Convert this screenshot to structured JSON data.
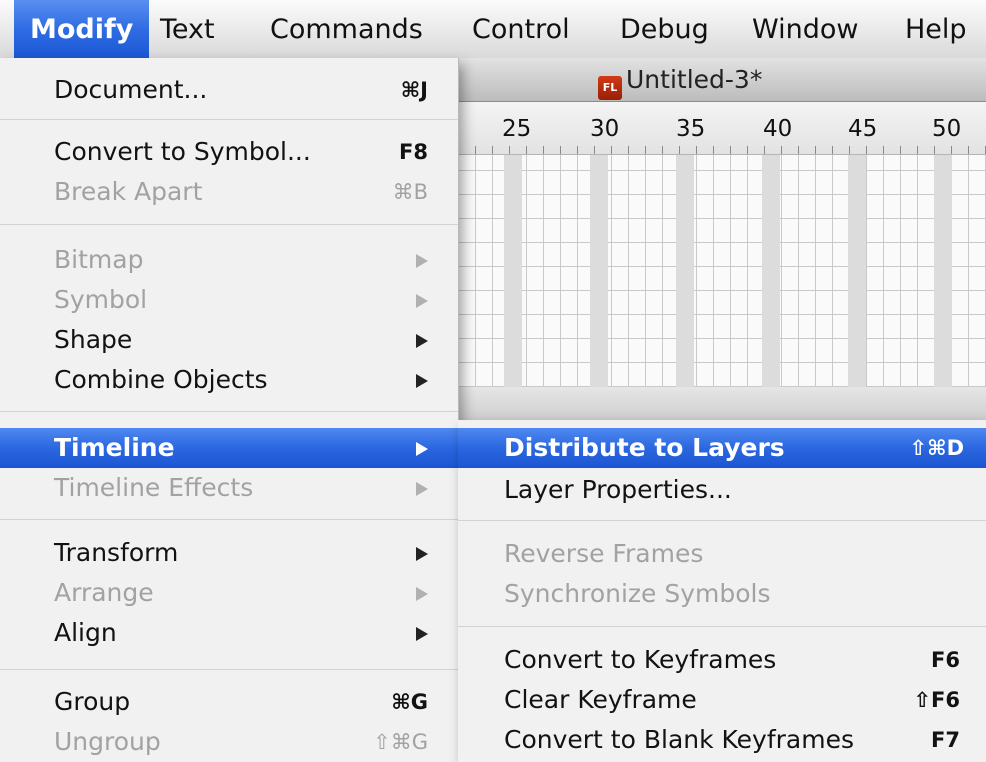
{
  "menubar": {
    "items": [
      "Modify",
      "Text",
      "Commands",
      "Control",
      "Debug",
      "Window",
      "Help"
    ]
  },
  "document": {
    "app_icon": "FL",
    "title": "Untitled-3*",
    "ruler": [
      "25",
      "30",
      "35",
      "40",
      "45",
      "50"
    ]
  },
  "modify_menu": {
    "document": {
      "label": "Document...",
      "shortcut": "⌘J"
    },
    "convert_symbol": {
      "label": "Convert to Symbol...",
      "shortcut": "F8"
    },
    "break_apart": {
      "label": "Break Apart",
      "shortcut": "⌘B"
    },
    "bitmap": {
      "label": "Bitmap"
    },
    "symbol": {
      "label": "Symbol"
    },
    "shape": {
      "label": "Shape"
    },
    "combine": {
      "label": "Combine Objects"
    },
    "timeline": {
      "label": "Timeline"
    },
    "timeline_effects": {
      "label": "Timeline Effects"
    },
    "transform": {
      "label": "Transform"
    },
    "arrange": {
      "label": "Arrange"
    },
    "align": {
      "label": "Align"
    },
    "group": {
      "label": "Group",
      "shortcut": "⌘G"
    },
    "ungroup": {
      "label": "Ungroup",
      "shortcut": "⇧⌘G"
    }
  },
  "timeline_submenu": {
    "distribute": {
      "label": "Distribute to Layers",
      "shortcut": "⇧⌘D"
    },
    "layer_props": {
      "label": "Layer Properties..."
    },
    "reverse": {
      "label": "Reverse Frames"
    },
    "sync": {
      "label": "Synchronize Symbols"
    },
    "convert_kf": {
      "label": "Convert to Keyframes",
      "shortcut": "F6"
    },
    "clear_kf": {
      "label": "Clear Keyframe",
      "shortcut": "⇧F6"
    },
    "convert_blank": {
      "label": "Convert to Blank Keyframes",
      "shortcut": "F7"
    }
  }
}
